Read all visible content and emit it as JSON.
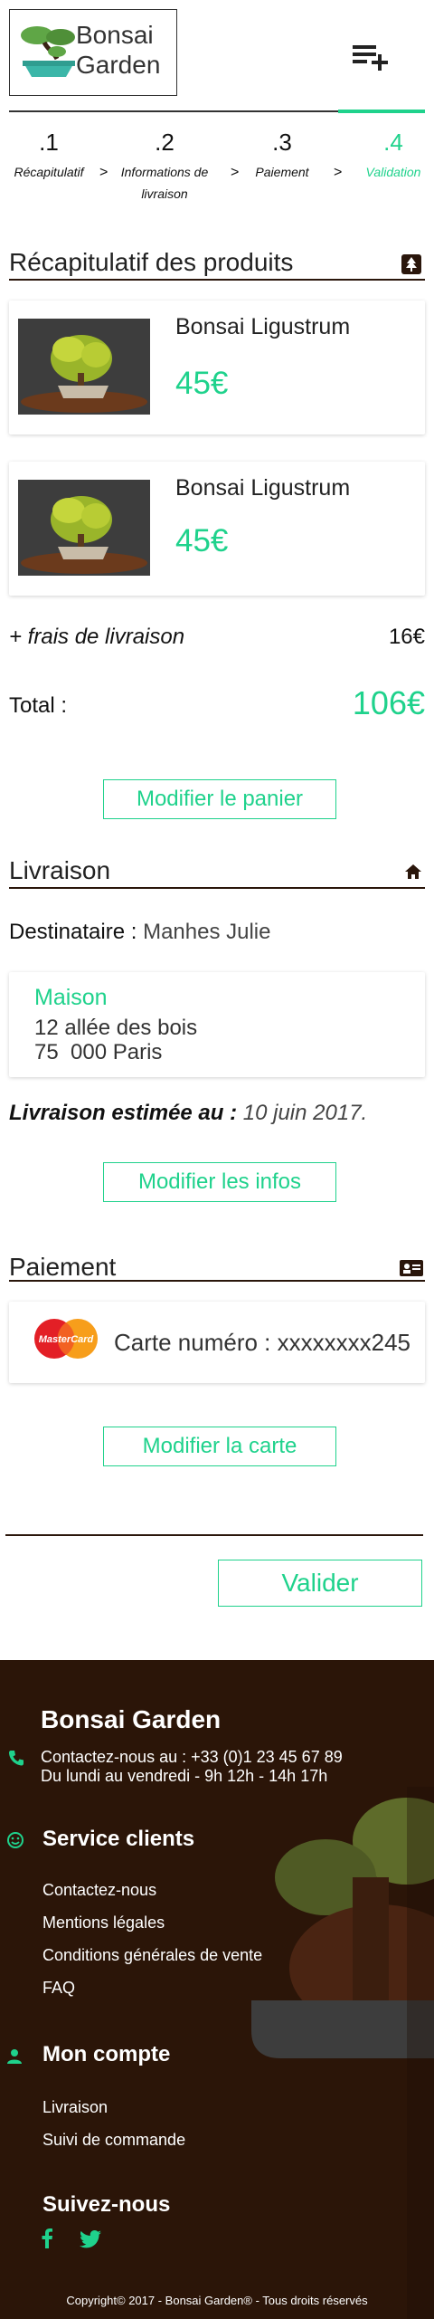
{
  "brand": {
    "line1": "Bonsai",
    "line2": "Garden"
  },
  "steps": [
    {
      "num": ".1",
      "label": "Récapitulatif"
    },
    {
      "num": ".2",
      "label_line1": "Informations de",
      "label_line2": "livraison"
    },
    {
      "num": ".3",
      "label": "Paiement"
    },
    {
      "num": ".4",
      "label": "Validation"
    }
  ],
  "step_separator": ">",
  "recap": {
    "title": "Récapitulatif des produits",
    "products": [
      {
        "name": "Bonsai Ligustrum",
        "price": "45€"
      },
      {
        "name": "Bonsai Ligustrum",
        "price": "45€"
      }
    ],
    "shipping_label": "+ frais de livraison",
    "shipping_value": "16€",
    "total_label": "Total :",
    "total_value": "106€",
    "edit_button": "Modifier le panier"
  },
  "delivery": {
    "title": "Livraison",
    "recipient_label": "Destinataire :",
    "recipient_name": "Manhes Julie",
    "address_name": "Maison",
    "address_line1": "12 allée des bois",
    "address_line2": "75  000 Paris",
    "estimate_label": "Livraison estimée au :",
    "estimate_date": "10 juin 2017.",
    "edit_button": "Modifier les infos"
  },
  "payment": {
    "title": "Paiement",
    "card_brand": "MasterCard",
    "card_text": "Carte numéro : xxxxxxxx245",
    "edit_button": "Modifier la carte"
  },
  "validate_button": "Valider",
  "footer": {
    "brand": "Bonsai Garden",
    "contact_line1": "Contactez-nous au : +33 (0)1 23 45 67 89",
    "contact_line2": "Du lundi au vendredi - 9h 12h - 14h 17h",
    "service_title": "Service clients",
    "service_links": [
      "Contactez-nous",
      "Mentions légales",
      "Conditions générales de vente",
      "FAQ"
    ],
    "account_title": "Mon compte",
    "account_links": [
      "Livraison",
      "Suivi de commande"
    ],
    "follow_title": "Suivez-nous",
    "copyright": "Copyright© 2017 - Bonsai Garden® - Tous droits réservés"
  },
  "colors": {
    "accent": "#1fd28c",
    "footer_bg": "#2b1508",
    "section_line": "#2a160b"
  },
  "icons": [
    "bonsai-logo-icon",
    "add-to-list-icon",
    "tree-icon",
    "home-icon",
    "id-card-icon",
    "mastercard-icon",
    "phone-icon",
    "smiley-icon",
    "user-icon",
    "facebook-icon",
    "twitter-icon"
  ]
}
